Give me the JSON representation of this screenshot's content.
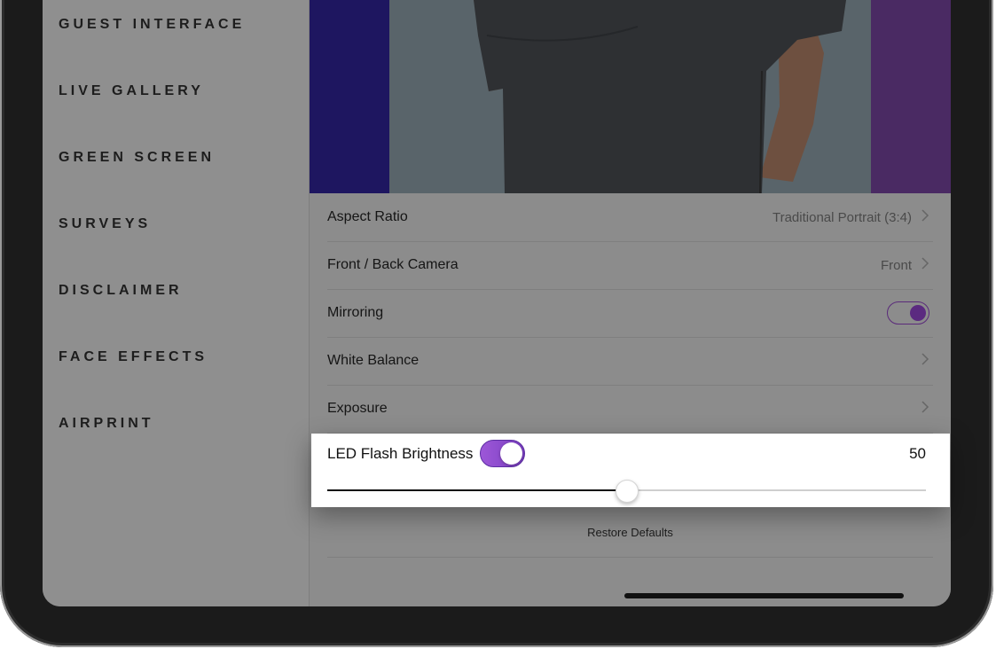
{
  "sidebar": {
    "items": [
      {
        "label": "GUEST INTERFACE"
      },
      {
        "label": "LIVE GALLERY"
      },
      {
        "label": "GREEN SCREEN"
      },
      {
        "label": "SURVEYS"
      },
      {
        "label": "DISCLAIMER"
      },
      {
        "label": "FACE EFFECTS"
      },
      {
        "label": "AIRPRINT"
      }
    ]
  },
  "settings": {
    "aspect_ratio": {
      "label": "Aspect Ratio",
      "value": "Traditional Portrait (3:4)"
    },
    "camera": {
      "label": "Front / Back Camera",
      "value": "Front"
    },
    "mirroring": {
      "label": "Mirroring",
      "enabled": true
    },
    "white_balance": {
      "label": "White Balance"
    },
    "exposure": {
      "label": "Exposure"
    },
    "led_flash": {
      "label": "LED Flash Brightness",
      "enabled": true,
      "value": "50",
      "level": 0.5
    },
    "restore_label": "Restore Defaults"
  },
  "colors": {
    "accent": "#8a4bd0",
    "highlight_panel": "#ffffff"
  }
}
